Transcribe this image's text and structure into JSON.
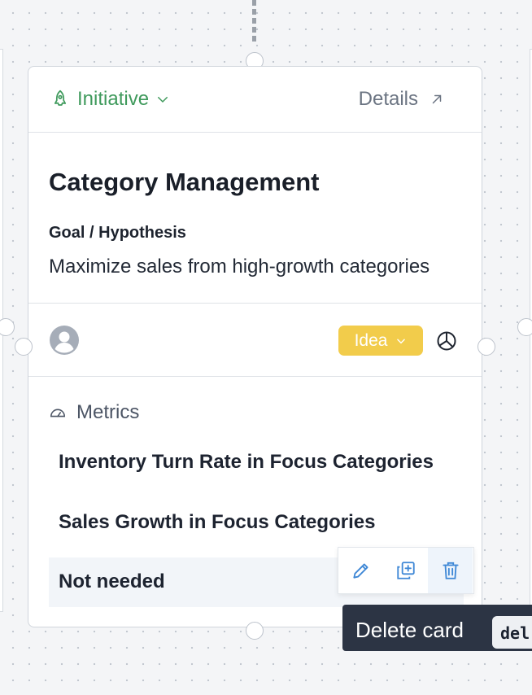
{
  "card": {
    "type_label": "Initiative",
    "details_label": "Details",
    "title": "Category Management",
    "goal_label": "Goal / Hypothesis",
    "goal_text": "Maximize sales from high-growth categories",
    "status": "Idea",
    "metrics_heading": "Metrics",
    "metrics": [
      "Inventory Turn Rate in Focus Categories",
      "Sales Growth in Focus Categories",
      "Not needed"
    ]
  },
  "row_actions": [
    "edit-icon",
    "duplicate-icon",
    "delete-icon"
  ],
  "tooltip": {
    "text": "Delete card",
    "shortcut": "del"
  },
  "colors": {
    "accent_green": "#3f9a5c",
    "status_yellow": "#f2cc4b",
    "tooltip_bg": "#2c3444"
  }
}
